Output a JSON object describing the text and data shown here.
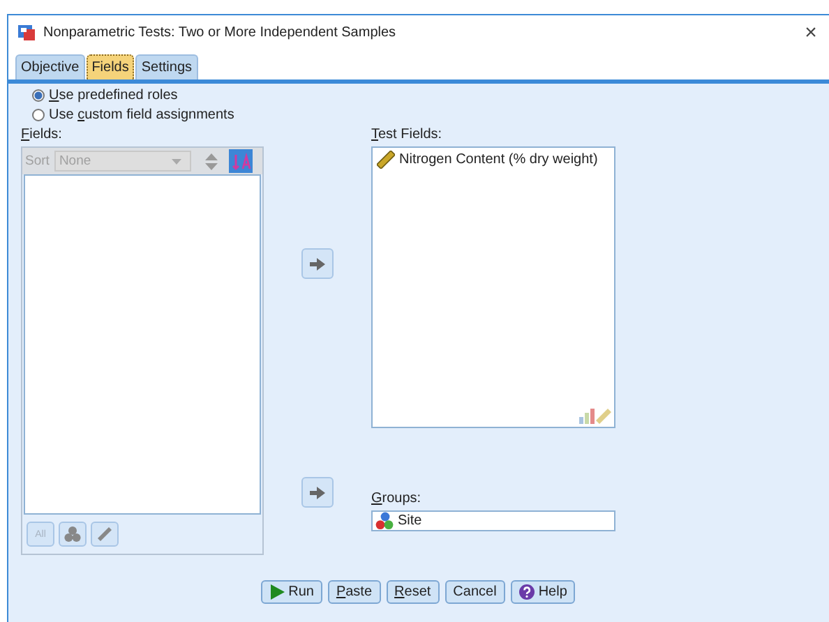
{
  "window": {
    "title": "Nonparametric Tests: Two or More Independent Samples",
    "close": "×"
  },
  "tabs": [
    {
      "label": "Objective",
      "selected": false
    },
    {
      "label": "Fields",
      "selected": true
    },
    {
      "label": "Settings",
      "selected": false
    }
  ],
  "roles": [
    {
      "label_parts": [
        {
          "text": "U",
          "underlined": true
        },
        {
          "text": "se predefined roles",
          "underlined": false
        }
      ],
      "selected": true
    },
    {
      "label_parts": [
        {
          "text": "Use ",
          "underlined": false
        },
        {
          "text": "c",
          "underlined": true
        },
        {
          "text": "ustom field assignments",
          "underlined": false
        }
      ],
      "selected": false
    }
  ],
  "fields_panel": {
    "label_parts": [
      {
        "text": "F",
        "underlined": true
      },
      {
        "text": "ields:",
        "underlined": false
      }
    ],
    "sort_label": "Sort",
    "sort_value": "None",
    "sort_disabled": true,
    "all_button": "All"
  },
  "test_fields": {
    "label_parts": [
      {
        "text": "T",
        "underlined": true
      },
      {
        "text": "est Fields:",
        "underlined": false
      }
    ],
    "items": [
      {
        "kind": "scale",
        "label": "Nitrogen Content (% dry weight)"
      }
    ]
  },
  "groups": {
    "label_parts": [
      {
        "text": "G",
        "underlined": true
      },
      {
        "text": "roups:",
        "underlined": false
      }
    ],
    "items": [
      {
        "kind": "nominal",
        "label": "Site"
      }
    ]
  },
  "buttons": [
    {
      "kind": "run",
      "label_parts": [
        {
          "text": "Run",
          "underlined": false
        }
      ]
    },
    {
      "kind": "plain",
      "label_parts": [
        {
          "text": "P",
          "underlined": true
        },
        {
          "text": "aste",
          "underlined": false
        }
      ]
    },
    {
      "kind": "plain",
      "label_parts": [
        {
          "text": "R",
          "underlined": true
        },
        {
          "text": "eset",
          "underlined": false
        }
      ]
    },
    {
      "kind": "plain",
      "label_parts": [
        {
          "text": "Cancel",
          "underlined": false
        }
      ]
    },
    {
      "kind": "help",
      "label_parts": [
        {
          "text": "Help",
          "underlined": false
        }
      ]
    }
  ]
}
